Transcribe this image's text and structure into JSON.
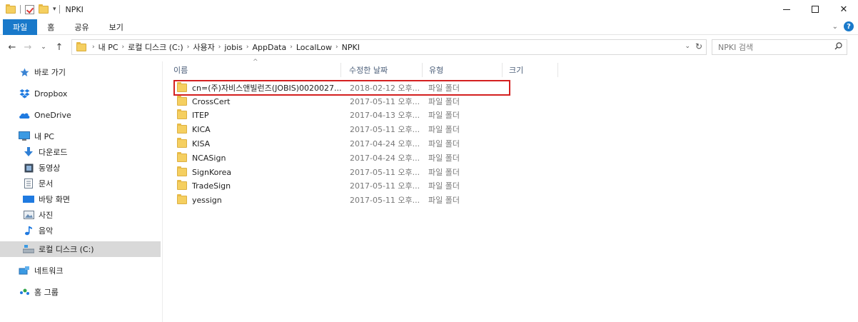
{
  "window": {
    "title": "NPKI",
    "minimize": "–",
    "close": "✕"
  },
  "ribbon": {
    "tabs": [
      "파일",
      "홈",
      "공유",
      "보기"
    ]
  },
  "address": {
    "crumbs": [
      "내 PC",
      "로컬 디스크 (C:)",
      "사용자",
      "jobis",
      "AppData",
      "LocalLow",
      "NPKI"
    ],
    "search_placeholder": "NPKI 검색"
  },
  "navigation": {
    "items": [
      {
        "label": "바로 가기",
        "icon": "star-icon"
      },
      {
        "label": "Dropbox",
        "icon": "dropbox-icon"
      },
      {
        "label": "OneDrive",
        "icon": "cloud-icon"
      },
      {
        "label": "내 PC",
        "icon": "computer-icon"
      },
      {
        "label": "다운로드",
        "icon": "download-icon"
      },
      {
        "label": "동영상",
        "icon": "video-icon"
      },
      {
        "label": "문서",
        "icon": "document-icon"
      },
      {
        "label": "바탕 화면",
        "icon": "desktop-icon"
      },
      {
        "label": "사진",
        "icon": "picture-icon"
      },
      {
        "label": "음악",
        "icon": "music-icon"
      },
      {
        "label": "로컬 디스크 (C:)",
        "icon": "drive-icon",
        "selected": true
      },
      {
        "label": "네트워크",
        "icon": "network-icon"
      },
      {
        "label": "홈 그룹",
        "icon": "homegroup-icon"
      }
    ]
  },
  "file_list": {
    "columns": [
      "이름",
      "수정한 날짜",
      "유형",
      "크기"
    ],
    "rows": [
      {
        "name": "cn=(주)자비스앤빌런즈(JOBIS)0020027...",
        "date": "2018-02-12 오후...",
        "type": "파일 폴더"
      },
      {
        "name": "CrossCert",
        "date": "2017-05-11 오후...",
        "type": "파일 폴더"
      },
      {
        "name": "ITEP",
        "date": "2017-04-13 오후...",
        "type": "파일 폴더"
      },
      {
        "name": "KICA",
        "date": "2017-05-11 오후...",
        "type": "파일 폴더"
      },
      {
        "name": "KISA",
        "date": "2017-04-24 오후...",
        "type": "파일 폴더"
      },
      {
        "name": "NCASign",
        "date": "2017-04-24 오후...",
        "type": "파일 폴더"
      },
      {
        "name": "SignKorea",
        "date": "2017-05-11 오후...",
        "type": "파일 폴더"
      },
      {
        "name": "TradeSign",
        "date": "2017-05-11 오후...",
        "type": "파일 폴더"
      },
      {
        "name": "yessign",
        "date": "2017-05-11 오후...",
        "type": "파일 폴더"
      }
    ]
  },
  "colors": {
    "accent": "#1979ca",
    "highlight_border": "#d42020",
    "folder": "#f5cf60"
  }
}
